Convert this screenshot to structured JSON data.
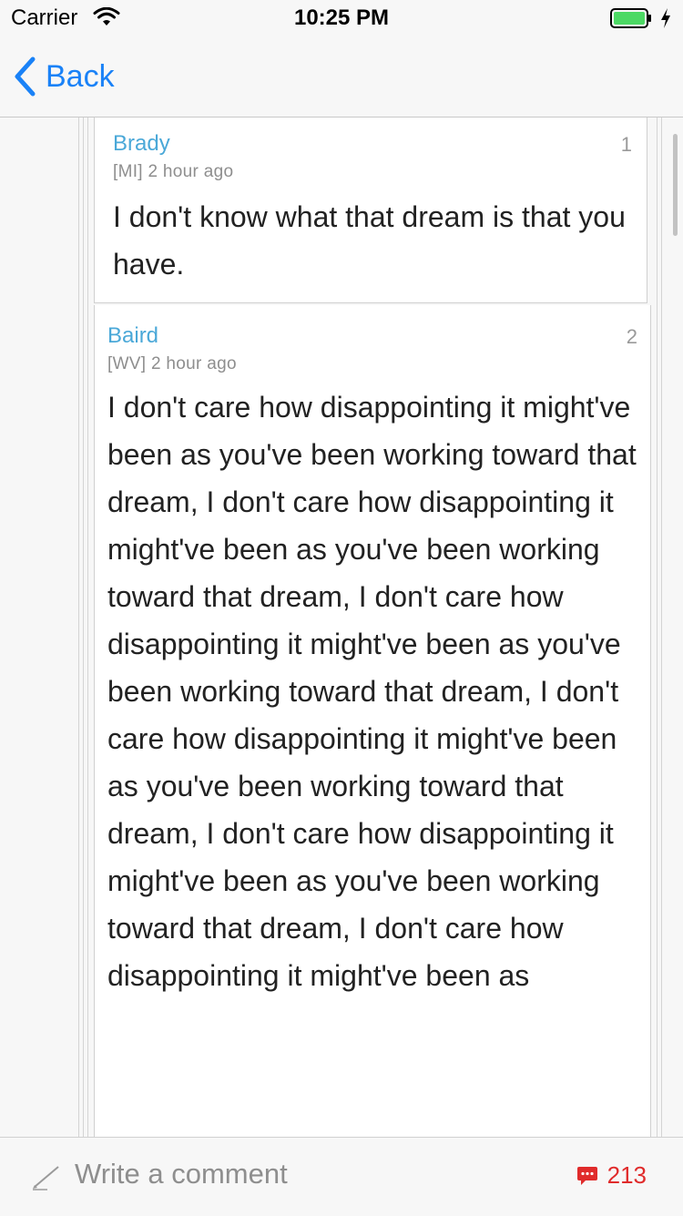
{
  "status_bar": {
    "carrier": "Carrier",
    "time": "10:25 PM"
  },
  "nav": {
    "back_label": "Back"
  },
  "comments": [
    {
      "author": "Brady",
      "region": "[MI]",
      "time": "2 hour ago",
      "number": "1",
      "text": "I don't know what that dream is that you have."
    },
    {
      "author": "Baird",
      "region": "[WV]",
      "time": "2 hour ago",
      "number": "2",
      "text": "I don't care how disappointing it might've been as you've been working toward that dream, I don't care how disappointing it might've been as you've been working toward that dream, I don't care how disappointing it might've been as you've been working toward that dream, I don't care how disappointing it might've been as you've been working toward that dream, I don't care how disappointing it might've been as you've been working toward that dream, I don't care how disappointing it might've been as"
    }
  ],
  "bottom_bar": {
    "placeholder": "Write a comment",
    "comment_count": "213"
  },
  "colors": {
    "accent": "#1a82f7",
    "author": "#4aa8d8",
    "count": "#e02b2b",
    "battery": "#4cd964"
  },
  "icons": {
    "wifi": "wifi-icon",
    "battery": "battery-icon",
    "charging": "charging-bolt-icon",
    "back": "chevron-left-icon",
    "pencil": "pencil-icon",
    "comments": "comment-bubble-icon"
  }
}
